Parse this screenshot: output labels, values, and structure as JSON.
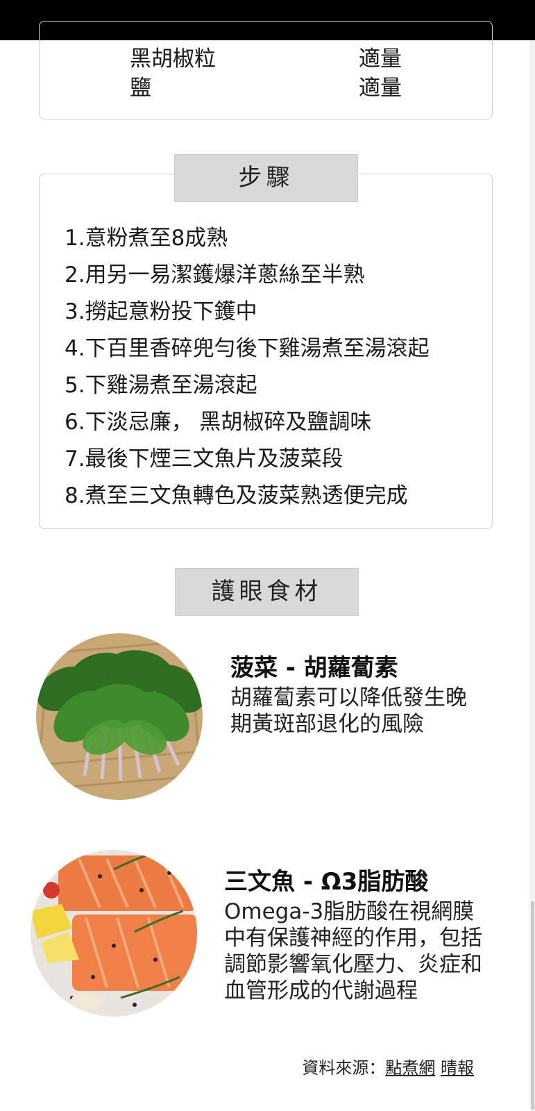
{
  "ingredients": [
    {
      "name": "黑胡椒粒",
      "amount": "適量"
    },
    {
      "name": "鹽",
      "amount": "適量"
    }
  ],
  "steps": {
    "title": "步驟",
    "items": [
      "1.意粉煮至8成熟",
      "2.用另一易潔鑊爆洋蔥絲至半熟",
      "3.撈起意粉投下鑊中",
      "4.下百里香碎兜勻後下雞湯煮至湯滾起",
      "5.下雞湯煮至湯滾起",
      "6.下淡忌廉， 黑胡椒碎及鹽調味",
      "7.最後下煙三文魚片及菠菜段",
      "8.煮至三文魚轉色及菠菜熟透便完成"
    ]
  },
  "eye_foods": {
    "title": "護眼食材",
    "items": [
      {
        "title": "菠菜 - 胡蘿蔔素",
        "desc": "胡蘿蔔素可以降低發生晚期黃斑部退化的風險",
        "image": "spinach-photo"
      },
      {
        "title": "三文魚 - Ω3脂肪酸",
        "desc": "Omega-3脂肪酸在視網膜中有保護神經的作用，包括調節影響氧化壓力、炎症和血管形成的代謝過程",
        "image": "salmon-photo"
      }
    ]
  },
  "source": {
    "label": "資料來源：",
    "links": [
      "點煮網",
      "晴報"
    ]
  }
}
